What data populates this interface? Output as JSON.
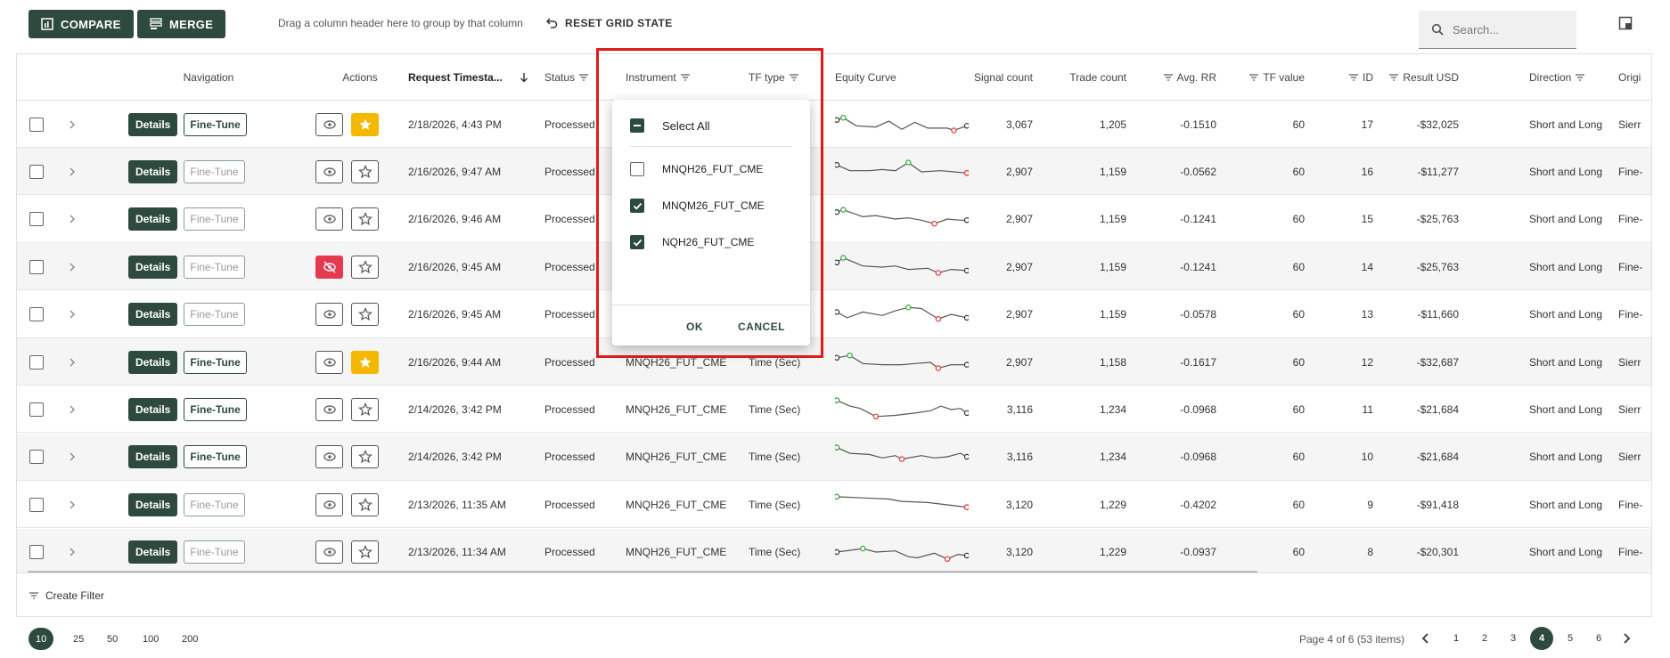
{
  "toolbar": {
    "compare_label": "COMPARE",
    "merge_label": "MERGE",
    "group_hint": "Drag a column header here to group by that column",
    "reset_label": "RESET GRID STATE",
    "search_placeholder": "Search..."
  },
  "columns": {
    "navigation": "Navigation",
    "actions": "Actions",
    "request_timestamp": "Request Timesta...",
    "status": "Status",
    "instrument": "Instrument",
    "tf_type": "TF type",
    "equity_curve": "Equity Curve",
    "signal_count": "Signal count",
    "trade_count": "Trade count",
    "avg_rr": "Avg. RR",
    "tf_value": "TF value",
    "id": "ID",
    "result_usd": "Result USD",
    "direction": "Direction",
    "origin": "Origi"
  },
  "button_labels": {
    "details": "Details",
    "fine_tune": "Fine-Tune"
  },
  "rows": [
    {
      "ts": "2/18/2026, 4:43 PM",
      "status": "Processed",
      "instrument": "",
      "tf_type": "",
      "signal": "3,067",
      "trade": "1,205",
      "rr": "-0.1510",
      "tf": "60",
      "id": "17",
      "usd": "-$32,025",
      "dir": "Short and Long",
      "origin": "Sierr",
      "fine_active": true,
      "hidden": false,
      "fav": true
    },
    {
      "ts": "2/16/2026, 9:47 AM",
      "status": "Processed",
      "instrument": "",
      "tf_type": "",
      "signal": "2,907",
      "trade": "1,159",
      "rr": "-0.0562",
      "tf": "60",
      "id": "16",
      "usd": "-$11,277",
      "dir": "Short and Long",
      "origin": "Fine-",
      "fine_active": false,
      "hidden": false,
      "fav": false
    },
    {
      "ts": "2/16/2026, 9:46 AM",
      "status": "Processed",
      "instrument": "",
      "tf_type": "",
      "signal": "2,907",
      "trade": "1,159",
      "rr": "-0.1241",
      "tf": "60",
      "id": "15",
      "usd": "-$25,763",
      "dir": "Short and Long",
      "origin": "Fine-",
      "fine_active": false,
      "hidden": false,
      "fav": false
    },
    {
      "ts": "2/16/2026, 9:45 AM",
      "status": "Processed",
      "instrument": "",
      "tf_type": "",
      "signal": "2,907",
      "trade": "1,159",
      "rr": "-0.1241",
      "tf": "60",
      "id": "14",
      "usd": "-$25,763",
      "dir": "Short and Long",
      "origin": "Fine-",
      "fine_active": false,
      "hidden": true,
      "fav": false
    },
    {
      "ts": "2/16/2026, 9:45 AM",
      "status": "Processed",
      "instrument": "",
      "tf_type": "",
      "signal": "2,907",
      "trade": "1,159",
      "rr": "-0.0578",
      "tf": "60",
      "id": "13",
      "usd": "-$11,660",
      "dir": "Short and Long",
      "origin": "Fine-",
      "fine_active": false,
      "hidden": false,
      "fav": false
    },
    {
      "ts": "2/16/2026, 9:44 AM",
      "status": "Processed",
      "instrument": "MNQH26_FUT_CME",
      "tf_type": "Time (Sec)",
      "signal": "2,907",
      "trade": "1,158",
      "rr": "-0.1617",
      "tf": "60",
      "id": "12",
      "usd": "-$32,687",
      "dir": "Short and Long",
      "origin": "Sierr",
      "fine_active": true,
      "hidden": false,
      "fav": true
    },
    {
      "ts": "2/14/2026, 3:42 PM",
      "status": "Processed",
      "instrument": "MNQH26_FUT_CME",
      "tf_type": "Time (Sec)",
      "signal": "3,116",
      "trade": "1,234",
      "rr": "-0.0968",
      "tf": "60",
      "id": "11",
      "usd": "-$21,684",
      "dir": "Short and Long",
      "origin": "Sierr",
      "fine_active": true,
      "hidden": false,
      "fav": false
    },
    {
      "ts": "2/14/2026, 3:42 PM",
      "status": "Processed",
      "instrument": "MNQH26_FUT_CME",
      "tf_type": "Time (Sec)",
      "signal": "3,116",
      "trade": "1,234",
      "rr": "-0.0968",
      "tf": "60",
      "id": "10",
      "usd": "-$21,684",
      "dir": "Short and Long",
      "origin": "Sierr",
      "fine_active": true,
      "hidden": false,
      "fav": false
    },
    {
      "ts": "2/13/2026, 11:35 AM",
      "status": "Processed",
      "instrument": "MNQH26_FUT_CME",
      "tf_type": "Time (Sec)",
      "signal": "3,120",
      "trade": "1,229",
      "rr": "-0.4202",
      "tf": "60",
      "id": "9",
      "usd": "-$91,418",
      "dir": "Short and Long",
      "origin": "Fine-",
      "fine_active": false,
      "hidden": false,
      "fav": false
    },
    {
      "ts": "2/13/2026, 11:34 AM",
      "status": "Processed",
      "instrument": "MNQH26_FUT_CME",
      "tf_type": "Time (Sec)",
      "signal": "3,120",
      "trade": "1,229",
      "rr": "-0.0937",
      "tf": "60",
      "id": "8",
      "usd": "-$20,301",
      "dir": "Short and Long",
      "origin": "Fine-",
      "fine_active": false,
      "hidden": false,
      "fav": false
    }
  ],
  "filter_popup": {
    "select_all": "Select All",
    "options": [
      {
        "label": "MNQH26_FUT_CME",
        "checked": false
      },
      {
        "label": "MNQM26_FUT_CME",
        "checked": true
      },
      {
        "label": "NQH26_FUT_CME",
        "checked": true
      }
    ],
    "ok_label": "OK",
    "cancel_label": "CANCEL"
  },
  "footer": {
    "create_filter": "Create Filter"
  },
  "pager": {
    "page_sizes": [
      "10",
      "25",
      "50",
      "100",
      "200"
    ],
    "selected_size": "10",
    "info": "Page 4 of 6 (53 items)",
    "pages": [
      "1",
      "2",
      "3",
      "4",
      "5",
      "6"
    ],
    "current_page": "4"
  },
  "colors": {
    "accent": "#2e4a3e",
    "highlight": "#e01b1b",
    "favorite": "#f5b800",
    "hidden": "#e53950"
  }
}
